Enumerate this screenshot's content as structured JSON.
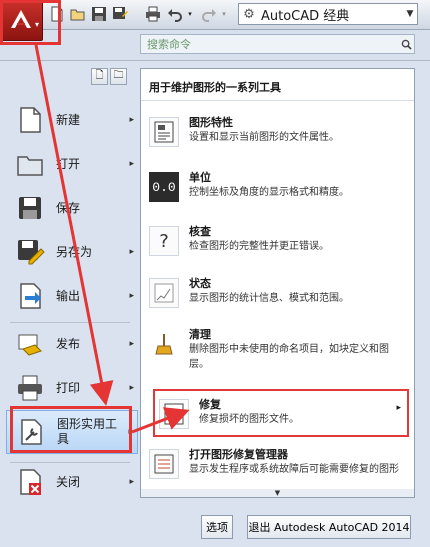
{
  "toolbar": {
    "workspace_value": "AutoCAD 经典",
    "icons": [
      "new-icon",
      "open-icon",
      "save-icon",
      "save-as-icon",
      "print-icon",
      "undo-icon",
      "redo-icon",
      "workspace-gear-icon"
    ]
  },
  "search": {
    "placeholder": "搜索命令"
  },
  "left_menu": {
    "items": [
      {
        "label": "新建",
        "icon": "new-document-icon",
        "submenu": "▸"
      },
      {
        "label": "打开",
        "icon": "open-folder-icon",
        "submenu": "▸"
      },
      {
        "label": "保存",
        "icon": "save-icon",
        "submenu": ""
      },
      {
        "label": "另存为",
        "icon": "save-as-icon",
        "submenu": "▸"
      },
      {
        "label": "输出",
        "icon": "export-icon",
        "submenu": "▸"
      },
      {
        "label": "发布",
        "icon": "publish-icon",
        "submenu": "▸"
      },
      {
        "label": "打印",
        "icon": "print-icon",
        "submenu": "▸"
      },
      {
        "label": "图形实用工具",
        "icon": "drawing-utilities-icon",
        "submenu": "▸"
      },
      {
        "label": "关闭",
        "icon": "close-icon",
        "submenu": "▸"
      }
    ]
  },
  "panel": {
    "header": "用于维护图形的一系列工具",
    "items": [
      {
        "title": "图形特性",
        "desc": "设置和显示当前图形的文件属性。"
      },
      {
        "title": "单位",
        "desc": "控制坐标及角度的显示格式和精度。",
        "icon_text": "0.0"
      },
      {
        "title": "核查",
        "desc": "检查图形的完整性并更正错误。",
        "icon_text": "?"
      },
      {
        "title": "状态",
        "desc": "显示图形的统计信息、模式和范围。"
      },
      {
        "title": "清理",
        "desc": "删除图形中未使用的命名项目，如块定义和图层。"
      },
      {
        "title": "修复",
        "desc": "修复损坏的图形文件。",
        "submenu": "▸"
      },
      {
        "title": "打开图形修复管理器",
        "desc": "显示发生程序或系统故障后可能需要修复的图形"
      }
    ],
    "scroll_indicator": "▼"
  },
  "buttons": {
    "options": "选项",
    "exit": "退出 Autodesk AutoCAD 2014"
  },
  "colors": {
    "annotation_red": "#e43434",
    "app_button": "#c9302a"
  }
}
